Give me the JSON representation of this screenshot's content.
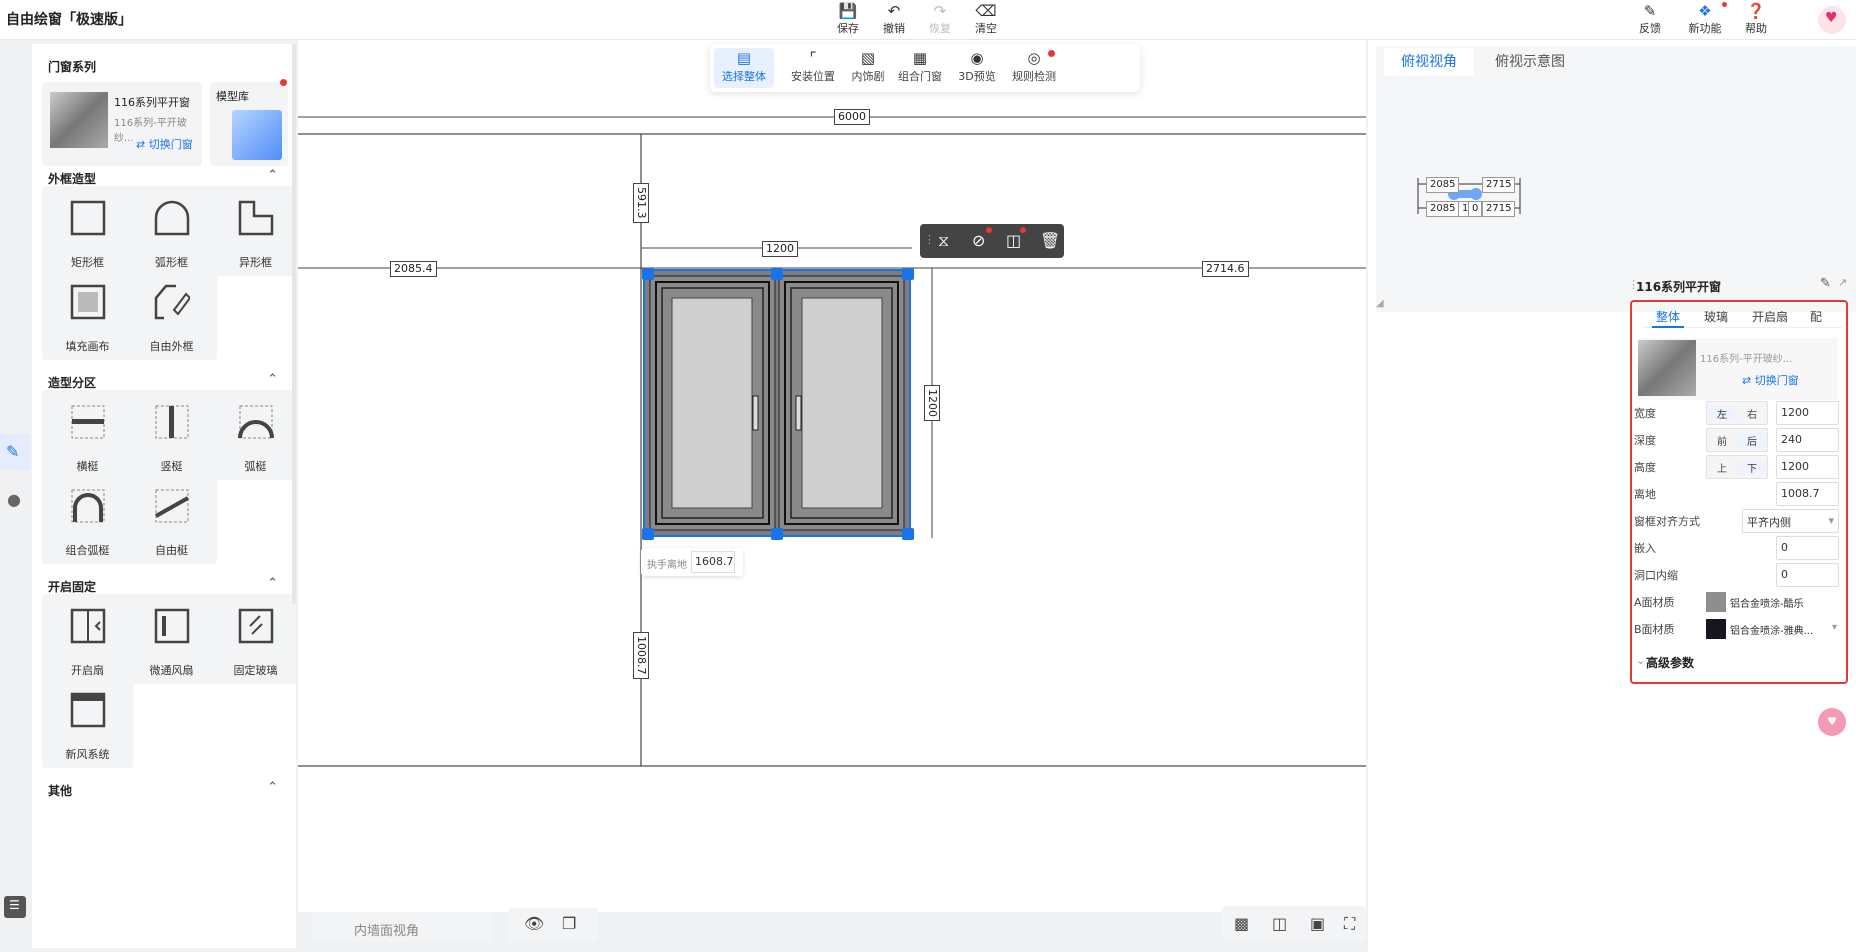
{
  "app_title": "自由绘窗「极速版」",
  "top_toolbar": {
    "save": "保存",
    "undo": "撤销",
    "redo": "恢复",
    "clear": "清空"
  },
  "top_right": {
    "feedback": "反馈",
    "new_features": "新功能",
    "help": "帮助"
  },
  "float_toolbar": {
    "select_all": "选择整体",
    "install_position": "安装位置",
    "interior": "内饰剧",
    "combo_window": "组合门窗",
    "preview_3d": "3D预览",
    "rule_check": "规则检测"
  },
  "left_panel": {
    "series_title": "门窗系列",
    "series_name": "116系列平开窗",
    "series_sub": "116系列-平开玻纱...",
    "switch_window": "切换门窗",
    "model_library": "模型库",
    "frame_section": "外框造型",
    "frame_items": [
      "矩形框",
      "弧形框",
      "异形框",
      "填充画布",
      "自由外框"
    ],
    "partition_section": "造型分区",
    "partition_items": [
      "横梃",
      "竖梃",
      "弧梃",
      "组合弧梃",
      "自由梃"
    ],
    "open_section": "开启固定",
    "open_items": [
      "开启扇",
      "微通风扇",
      "固定玻璃",
      "新风系统"
    ],
    "other_section": "其他"
  },
  "canvas": {
    "dim_total": "6000",
    "dim_left": "2085.4",
    "dim_right": "2714.6",
    "dim_width": "1200",
    "dim_height": "1200",
    "dim_top": "591.3",
    "dim_bottom": "1008.7",
    "handle_label": "执手离地",
    "handle_value": "1608.7"
  },
  "bottom_bar": {
    "wall_view": "内墙面视角"
  },
  "right_panel": {
    "tab_top": "俯视视角",
    "tab_schema": "俯视示意图",
    "mini_left": "2085",
    "mini_right": "2715",
    "mini_center": "1",
    "mini_center2": "0",
    "panel_title": "116系列平开窗",
    "tabs": [
      "整体",
      "玻璃",
      "开启扇",
      "配"
    ],
    "product_sub": "116系列-平开玻纱...",
    "switch_window": "切换门窗",
    "props": {
      "width_label": "宽度",
      "width_l": "左",
      "width_r": "右",
      "width_val": "1200",
      "depth_label": "深度",
      "depth_l": "前",
      "depth_r": "后",
      "depth_val": "240",
      "height_label": "高度",
      "height_l": "上",
      "height_r": "下",
      "height_val": "1200",
      "ground_label": "离地",
      "ground_val": "1008.7",
      "align_label": "窗框对齐方式",
      "align_val": "平齐内侧",
      "embed_label": "嵌入",
      "embed_val": "0",
      "shrink_label": "洞口内缩",
      "shrink_val": "0",
      "matA_label": "A面材质",
      "matA_val": "铝合金喷涂-酷乐",
      "matB_label": "B面材质",
      "matB_val": "铝合金喷涂-雅典...",
      "advanced": "高级参数"
    }
  },
  "colors": {
    "accent": "#1a73e8",
    "highlight": "#e53935",
    "frame_gray": "#8a8a8a",
    "matA": "#8e8e8e",
    "matB": "#16161e"
  }
}
